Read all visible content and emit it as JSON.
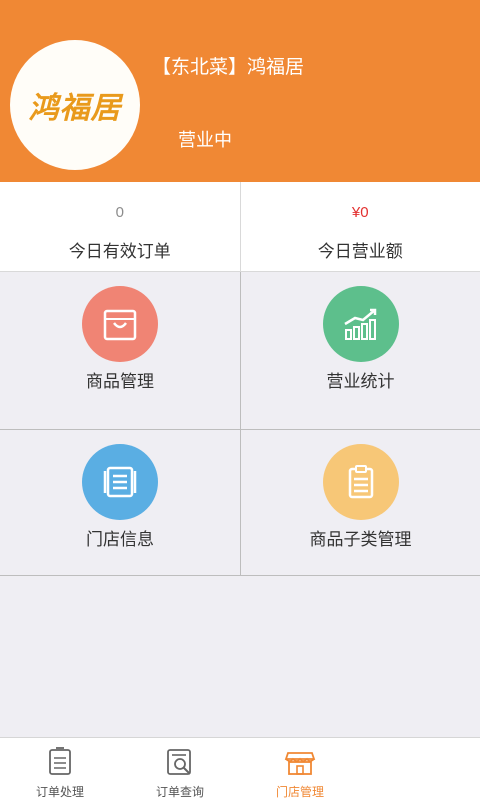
{
  "header": {
    "logo_text": "鸿福居",
    "shop_name": "【东北菜】鸿福居",
    "status": "营业中"
  },
  "stats": [
    {
      "value": "0",
      "label": "今日有效订单"
    },
    {
      "value": "¥0",
      "label": "今日营业额"
    }
  ],
  "menu": [
    {
      "label": "商品管理",
      "icon": "shopping-bag-icon",
      "color": "#f08474"
    },
    {
      "label": "营业统计",
      "icon": "bar-chart-icon",
      "color": "#5dbf8c"
    },
    {
      "label": "门店信息",
      "icon": "document-icon",
      "color": "#5aaee3"
    },
    {
      "label": "商品子类管理",
      "icon": "clipboard-icon",
      "color": "#f7c777"
    }
  ],
  "tabs": [
    {
      "label": "订单处理",
      "icon": "order-icon"
    },
    {
      "label": "订单查询",
      "icon": "order-search-icon"
    },
    {
      "label": "门店管理",
      "icon": "store-icon"
    },
    {
      "label": "",
      "icon": ""
    }
  ],
  "colors": {
    "accent": "#f08834",
    "value_red": "#e3302f"
  }
}
